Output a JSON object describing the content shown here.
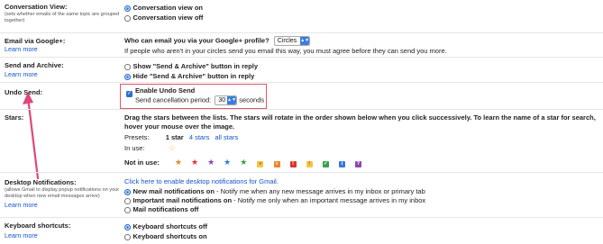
{
  "conversation": {
    "label": "Conversation View:",
    "sub": "(sets whether emails of the same topic are grouped together)",
    "opt_on": "Conversation view on",
    "opt_off": "Conversation view off"
  },
  "google_plus": {
    "label": "Email via Google+:",
    "learn": "Learn more",
    "question": "Who can email you via your Google+ profile?",
    "select_value": "Circles",
    "note": "If people who aren't in your circles send you email this way, you must agree before they can send you more."
  },
  "send_archive": {
    "label": "Send and Archive:",
    "learn": "Learn more",
    "opt_show": "Show \"Send & Archive\" button in reply",
    "opt_hide": "Hide \"Send & Archive\" button in reply"
  },
  "undo_send": {
    "label": "Undo Send:",
    "enable": "Enable Undo Send",
    "period_label": "Send cancellation period:",
    "period_value": "30",
    "unit": "seconds"
  },
  "stars": {
    "label": "Stars:",
    "instructions": "Drag the stars between the lists.  The stars will rotate in the order shown below when you click successively. To learn the name of a star for search, hover your mouse over the image.",
    "presets_label": "Presets:",
    "preset_1": "1 star",
    "preset_4": "4 stars",
    "preset_all": "all stars",
    "in_use_label": "In use:",
    "not_in_use_label": "Not in use:",
    "box_glyphs": [
      "»",
      "»",
      "!",
      "!",
      "✓",
      "i",
      "?"
    ],
    "colors": {
      "yellow": "#f4c542",
      "orange": "#e8852b",
      "red": "#d9372c",
      "purple": "#8e44ad",
      "green": "#3aa04a",
      "blue": "#3b78d8"
    }
  },
  "desktop": {
    "label": "Desktop Notifications:",
    "sub": "(allows Gmail to display popup notifications on your desktop when new email messages arrive)",
    "learn": "Learn more",
    "enable_link": "Click here to enable desktop notifications for Gmail.",
    "opt1_bold": "New mail notifications on",
    "opt1_rest": " - Notify me when any new message arrives in my inbox or primary tab",
    "opt2_bold": "Important mail notifications on",
    "opt2_rest": " - Notify me only when an important message arrives in my inbox",
    "opt3": "Mail notifications off"
  },
  "shortcuts": {
    "label": "Keyboard shortcuts:",
    "learn": "Learn more",
    "opt_off": "Keyboard shortcuts off",
    "opt_on": "Keyboard shortcuts on"
  }
}
